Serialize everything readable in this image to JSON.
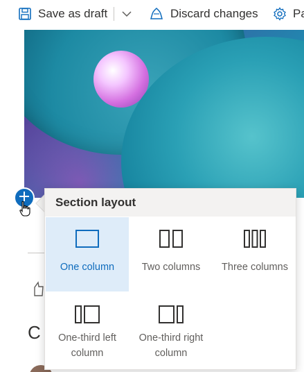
{
  "toolbar": {
    "save_label": "Save as draft",
    "discard_label": "Discard changes",
    "page_label": "Pa"
  },
  "flyout": {
    "title": "Section layout",
    "options": [
      {
        "label": "One column",
        "selected": true
      },
      {
        "label": "Two columns",
        "selected": false
      },
      {
        "label": "Three columns",
        "selected": false
      },
      {
        "label": "One-third left column",
        "selected": false
      },
      {
        "label": "One-third right column",
        "selected": false
      }
    ]
  },
  "colors": {
    "accent": "#0f6cbd",
    "selected_bg": "#deecf9",
    "header_bg": "#f3f2f1",
    "text": "#323130",
    "text_secondary": "#605e5c"
  },
  "icons": {
    "save": "save-icon",
    "chevron": "chevron-down-icon",
    "discard": "discard-icon",
    "settings": "gear-icon",
    "add": "plus-icon",
    "cursor": "hand-cursor-icon"
  },
  "behind": {
    "partial_letter": "C"
  }
}
